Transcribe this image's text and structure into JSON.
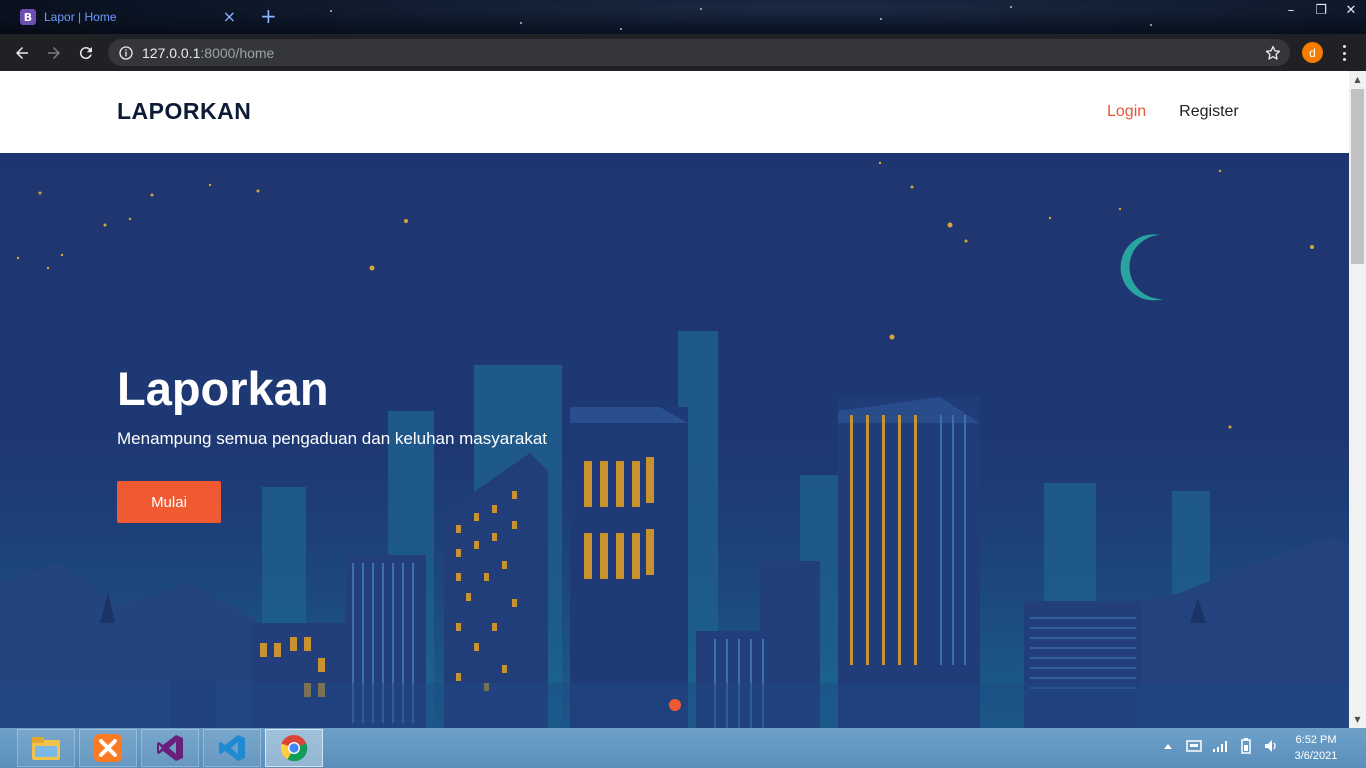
{
  "browser": {
    "tab_title": "Lapor | Home",
    "favicon_letter": "B",
    "close_tab_glyph": "×",
    "new_tab_glyph": "+",
    "url_host": "127.0.0.1",
    "url_path": ":8000/home",
    "profile_initial": "d",
    "window_controls": {
      "minimize": "–",
      "restore": "❐",
      "close": "✕"
    }
  },
  "site": {
    "brand": "LAPORKAN",
    "nav": {
      "login": "Login",
      "register": "Register"
    },
    "hero": {
      "title": "Laporkan",
      "subtitle": "Menampung semua pengaduan dan keluhan masyarakat",
      "cta": "Mulai"
    }
  },
  "taskbar": {
    "apps": [
      "file-explorer-icon",
      "xampp-icon",
      "visual-studio-icon",
      "vscode-icon",
      "chrome-icon"
    ],
    "active_app": "chrome-icon",
    "time": "6:52 PM",
    "date": "3/6/2021"
  },
  "colors": {
    "accent": "#ef5a33",
    "brand_text": "#0e1b38",
    "hero_bg": "#1f3570",
    "taskbar": "#5a8fbb"
  }
}
